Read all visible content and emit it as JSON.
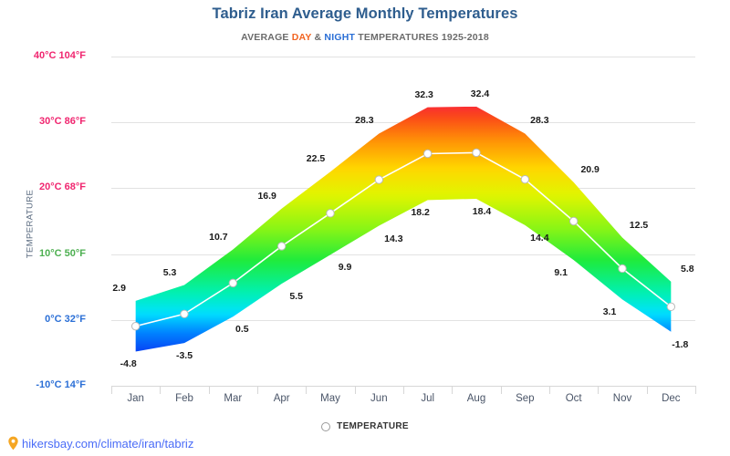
{
  "header": {
    "title": "Tabriz Iran Average Monthly Temperatures",
    "subtitle_pre": "AVERAGE ",
    "subtitle_day": "DAY",
    "subtitle_amp": " & ",
    "subtitle_night": "NIGHT",
    "subtitle_post": " TEMPERATURES 1925-2018"
  },
  "axis": {
    "y_title": "TEMPERATURE"
  },
  "legend": {
    "label": "TEMPERATURE",
    "marker": "circle-outline-icon"
  },
  "footer": {
    "icon": "map-pin-icon",
    "link": "hikersbay.com/climate/iran/tabriz"
  },
  "colors": {
    "title": "#2e5d8e",
    "day": "#f26522",
    "night": "#2b6fd6",
    "link": "#4a6cf7",
    "pin": "#f5a623",
    "grid": "#e2e2e2",
    "line": "#ffffff",
    "label": "#1a1a1a",
    "tick_hot": "#f0256f",
    "tick_warm": "#4caf50",
    "tick_cold": "#2b6fd6"
  },
  "chart_data": {
    "type": "area",
    "title": "Tabriz Iran Average Monthly Temperatures",
    "subtitle": "AVERAGE DAY & NIGHT TEMPERATURES 1925-2018",
    "xlabel": "",
    "ylabel": "TEMPERATURE",
    "categories": [
      "Jan",
      "Feb",
      "Mar",
      "Apr",
      "May",
      "Jun",
      "Jul",
      "Aug",
      "Sep",
      "Oct",
      "Nov",
      "Dec"
    ],
    "series": [
      {
        "name": "DAY",
        "values": [
          2.9,
          5.3,
          10.7,
          16.9,
          22.5,
          28.3,
          32.3,
          32.4,
          28.3,
          20.9,
          12.5,
          5.8
        ]
      },
      {
        "name": "NIGHT",
        "values": [
          -4.8,
          -3.5,
          0.5,
          5.5,
          9.9,
          14.3,
          18.2,
          18.4,
          14.4,
          9.1,
          3.1,
          -1.8
        ]
      }
    ],
    "average": [
      -0.95,
      0.9,
      5.6,
      11.2,
      16.2,
      21.3,
      25.25,
      25.4,
      21.35,
      15.0,
      7.8,
      2.0
    ],
    "ylim": [
      -10,
      40
    ],
    "y_ticks": [
      {
        "value": 40,
        "label": "40°C 104°F",
        "color": "#f0256f"
      },
      {
        "value": 30,
        "label": "30°C 86°F",
        "color": "#f0256f"
      },
      {
        "value": 20,
        "label": "20°C 68°F",
        "color": "#f0256f"
      },
      {
        "value": 10,
        "label": "10°C 50°F",
        "color": "#4caf50"
      },
      {
        "value": 0,
        "label": "0°C 32°F",
        "color": "#2b6fd6"
      },
      {
        "value": -10,
        "label": "-10°C 14°F",
        "color": "#2b6fd6"
      }
    ],
    "grid": true,
    "legend_position": "bottom",
    "units": "celsius-fahrenheit"
  }
}
